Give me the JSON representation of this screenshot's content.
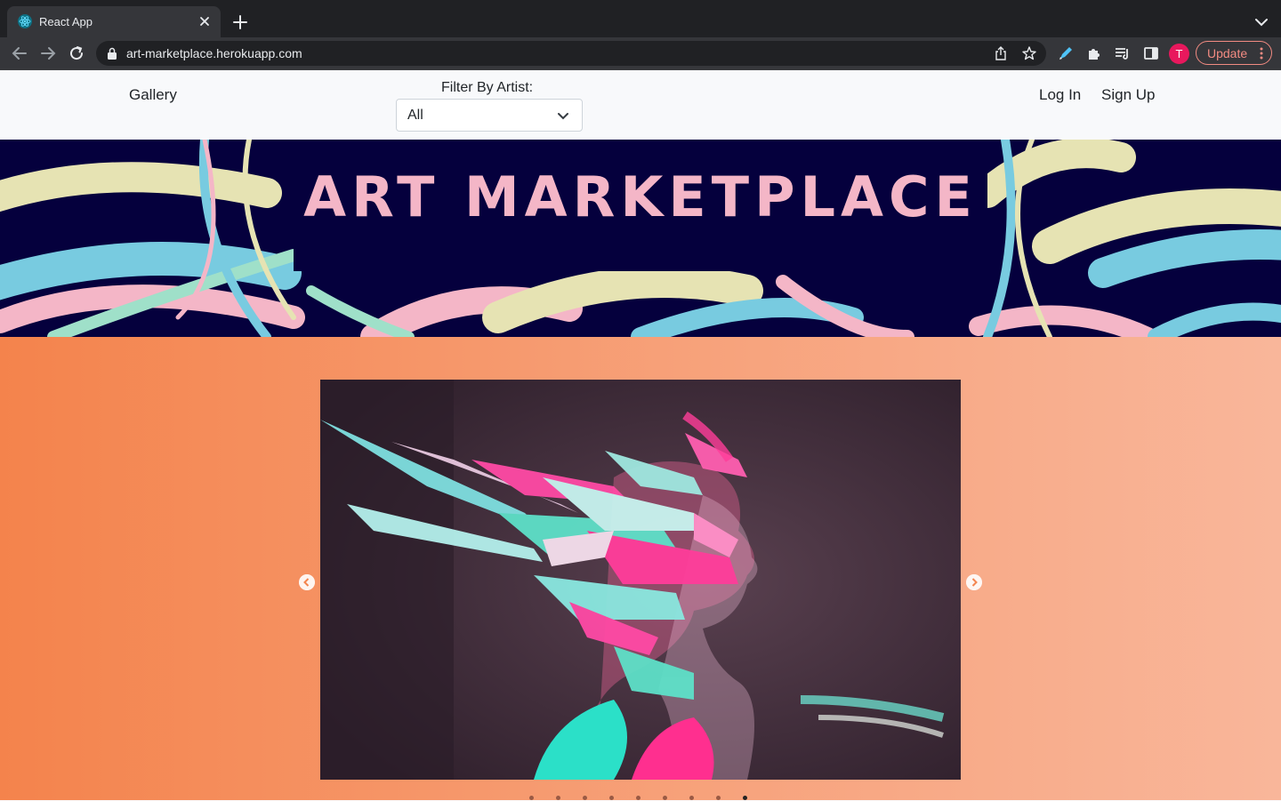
{
  "browser": {
    "tab_title": "React App",
    "url": "art-marketplace.herokuapp.com",
    "avatar_letter": "T",
    "update_label": "Update"
  },
  "nav": {
    "gallery_label": "Gallery",
    "filter_label": "Filter By Artist:",
    "filter_value": "All",
    "login_label": "Log In",
    "signup_label": "Sign Up"
  },
  "hero": {
    "title": "ART MARKETPLACE"
  },
  "carousel": {
    "slide_count": 9,
    "active_index": 8
  },
  "colors": {
    "hero_bg": "#05003d",
    "hero_title": "#f4b6c7",
    "gallery_gradient_start": "#f4834c",
    "gallery_gradient_end": "#f9b69a",
    "update_accent": "#f28b82"
  }
}
